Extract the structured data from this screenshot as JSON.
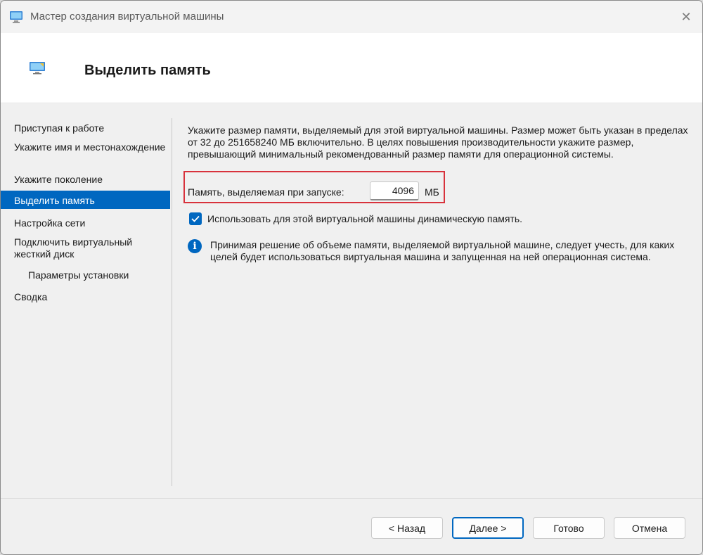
{
  "window": {
    "title": "Мастер создания виртуальной машины",
    "close_glyph": "✕"
  },
  "header": {
    "title": "Выделить память"
  },
  "nav": {
    "items": [
      {
        "label": "Приступая к работе"
      },
      {
        "label": "Укажите имя и местонахождение"
      },
      {
        "label": "Укажите поколение"
      },
      {
        "label": "Выделить память"
      },
      {
        "label": "Настройка сети"
      },
      {
        "label": "Подключить виртуальный жесткий диск"
      },
      {
        "label": "Параметры установки"
      },
      {
        "label": "Сводка"
      }
    ]
  },
  "content": {
    "description": "Укажите размер памяти, выделяемый для этой виртуальной машины. Размер может быть указан в пределах от 32 до 251658240 МБ включительно. В целях повышения производительности укажите размер, превышающий минимальный рекомендованный размер памяти для операционной системы.",
    "memory_label": "Память, выделяемая при запуске:",
    "memory_value": "4096",
    "memory_unit": "МБ",
    "dynamic_memory_label": "Использовать для этой виртуальной машины динамическую память.",
    "dynamic_memory_checked": true,
    "info_glyph": "i",
    "info_text": "Принимая решение об объеме памяти, выделяемой виртуальной машине, следует учесть, для каких целей будет использоваться виртуальная машина и запущенная на ней операционная система."
  },
  "footer": {
    "back_label": "< Назад",
    "next_label": "Далее >",
    "finish_label": "Готово",
    "cancel_label": "Отмена"
  },
  "colors": {
    "accent": "#0067c0",
    "highlight_border": "#d8323c"
  },
  "icons": {
    "app": "monitor-icon",
    "header": "monitor-icon",
    "check": "check-icon",
    "info": "info-icon"
  }
}
